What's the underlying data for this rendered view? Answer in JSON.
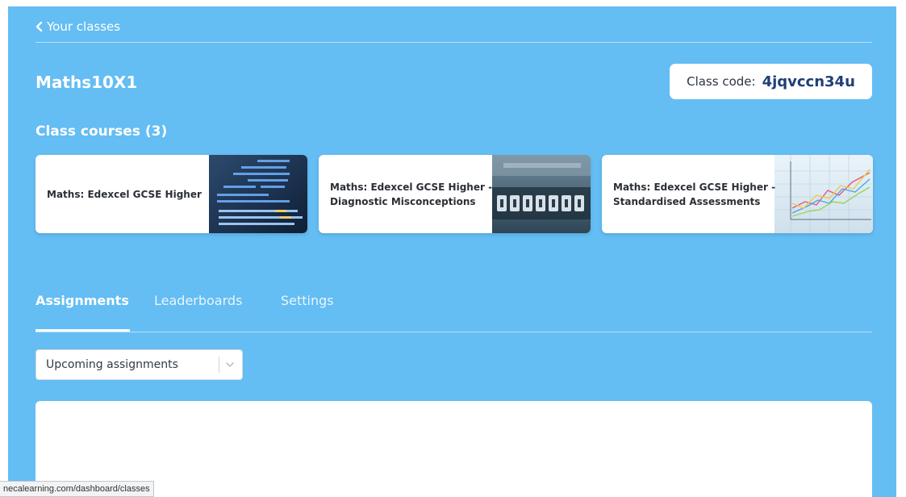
{
  "nav": {
    "back_label": "Your classes"
  },
  "class_info": {
    "name": "Maths10X1",
    "code_label": "Class code:",
    "code_value": "4jqvccn34u"
  },
  "courses": {
    "heading": "Class courses (3)",
    "items": [
      {
        "title": "Maths: Edexcel GCSE Higher",
        "thumbnail": "code-screen-image"
      },
      {
        "title": "Maths: Edexcel GCSE Higher -\nDiagnostic Misconceptions",
        "thumbnail": "counter-dial-image"
      },
      {
        "title": "Maths: Edexcel GCSE Higher -\nStandardised Assessments",
        "thumbnail": "line-graph-image"
      }
    ]
  },
  "tabs": [
    {
      "label": "Assignments",
      "active": true
    },
    {
      "label": "Leaderboards",
      "active": false
    },
    {
      "label": "Settings",
      "active": false
    }
  ],
  "assignment_filter": {
    "selected": "Upcoming assignments"
  },
  "status_bar": {
    "url": "necalearning.com/dashboard/classes"
  },
  "colors": {
    "background": "#64bdf3",
    "card": "#ffffff",
    "code_value": "#1f3f78"
  }
}
